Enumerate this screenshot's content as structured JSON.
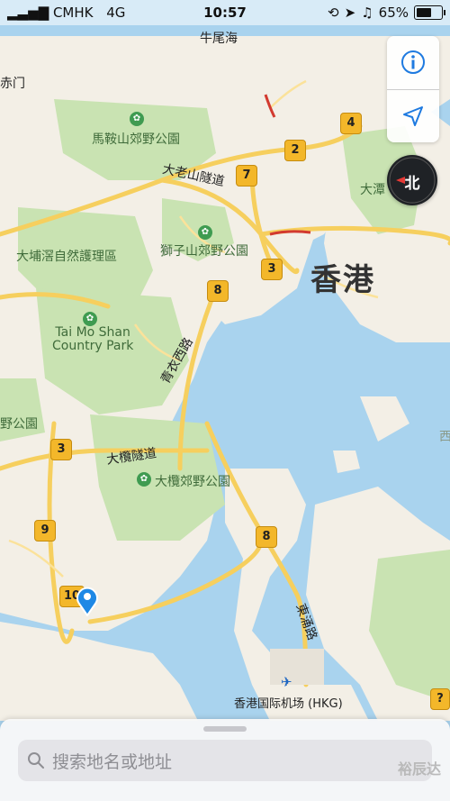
{
  "status_bar": {
    "carrier": "CMHK",
    "network": "4G",
    "time": "10:57",
    "battery": "65%",
    "battery_level": 0.65
  },
  "controls": {
    "info_icon": "info-icon",
    "location_icon": "location-arrow-icon",
    "compass_label": "北"
  },
  "map": {
    "city_label": "香港",
    "place_labels": {
      "niu_wei_hai": "牛尾海",
      "chi_men": "赤门",
      "ma_on_shan": "馬鞍山郊野公園",
      "tai_lo_shan": "大老山隧道",
      "da_tam": "大潭",
      "tai_po": "大埔滘自然護理區",
      "lion_rock": "獅子山郊野公園",
      "tai_mo_shan": "Tai Mo Shan\nCountry Park",
      "zhi_ye_gong_yuan": "野公園",
      "tsing_yi_road": "青衣西路",
      "tai_lam_tunnel": "大欖隧道",
      "tai_lam_park": "大欖郊野公園",
      "tung_chung_road": "東涌路",
      "airport": "香港国际机场 (HKG)",
      "xi": "西"
    },
    "route_shields": [
      "4",
      "2",
      "7",
      "3",
      "8",
      "3",
      "9",
      "10",
      "8"
    ]
  },
  "search": {
    "placeholder": "搜索地名或地址",
    "watermark": "裕辰达"
  },
  "colors": {
    "water": "#a9d3ee",
    "land": "#f3efe6",
    "park": "#c9e3b2",
    "road": "#f6cf5e",
    "accent": "#1e88e5"
  }
}
